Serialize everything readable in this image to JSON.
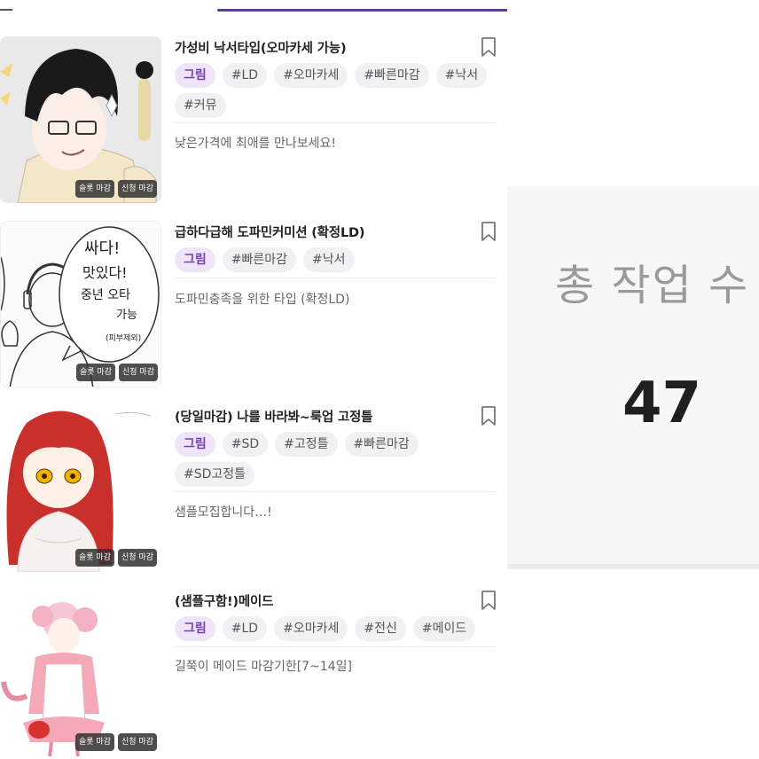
{
  "cards": [
    {
      "title": "가성비 낙서타입(오마카세 가능)",
      "tags": [
        "그림",
        "#LD",
        "#오마카세",
        "#빠른마감",
        "#낙서",
        "#커뮤"
      ],
      "description": "낮은가격에 최애를 만나보세요!",
      "badges": {
        "slot": "슬롯 마감",
        "apply": "신청 마감"
      }
    },
    {
      "title": "급하다급해 도파민커미션 (확정LD)",
      "tags": [
        "그림",
        "#빠른마감",
        "#낙서"
      ],
      "description": "도파민충족을 위한 타입 (확정LD)",
      "badges": {
        "slot": "슬롯 마감",
        "apply": "신청 마감"
      },
      "art_text": [
        "싸다!",
        "맛있다!",
        "중년 오타",
        "가능",
        "(피부제외)"
      ]
    },
    {
      "title": "(당일마감) 나를 바라봐~룩업 고정틀",
      "tags": [
        "그림",
        "#SD",
        "#고정틀",
        "#빠른마감",
        "#SD고정틀"
      ],
      "description": "샘플모집합니다…!",
      "badges": {
        "slot": "슬롯 마감",
        "apply": "신청 마감"
      }
    },
    {
      "title": "(샘플구함!)메이드",
      "tags": [
        "그림",
        "#LD",
        "#오마카세",
        "#전신",
        "#메이드"
      ],
      "description": "길쭉이 메이드 마감기한[7~14일]",
      "badges": {
        "slot": "슬롯 마감",
        "apply": "신청 마감"
      }
    }
  ],
  "stats": {
    "label": "총 작업 수",
    "value": "47"
  },
  "colors": {
    "accent": "#7a3db8",
    "tab_indicator": "#5c3d8f",
    "tag_primary_bg": "#efe5f7",
    "tag_bg": "#f1f1f3"
  },
  "icons": {
    "bookmark": "bookmark-icon"
  }
}
